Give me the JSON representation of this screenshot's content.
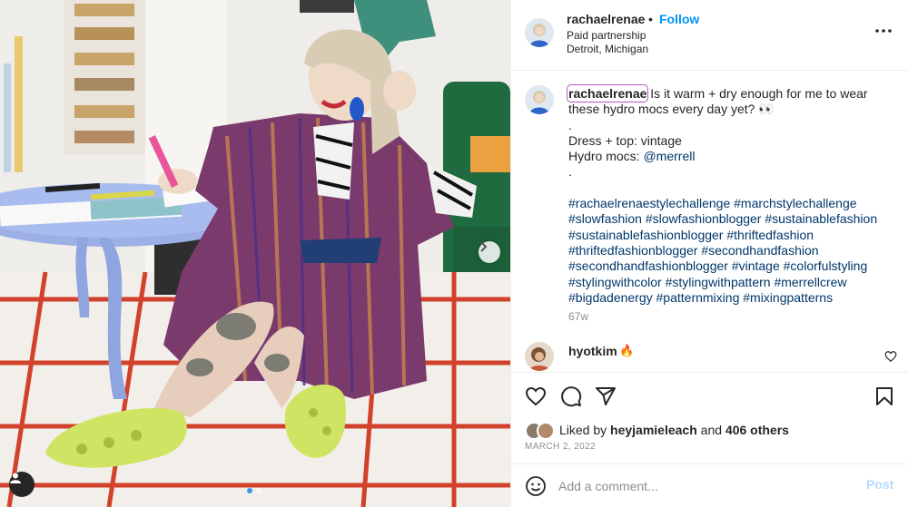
{
  "post": {
    "author": "rachaelrenae",
    "bullet": "•",
    "follow_label": "Follow",
    "partnership": "Paid partnership",
    "location": "Detroit, Michigan"
  },
  "caption": {
    "username": "rachaelrenae",
    "line1": " Is it warm + dry enough for me to wear",
    "line2": "these hydro mocs every day yet? 👀",
    "line3": ".",
    "line4": "Dress + top: vintage",
    "line5_prefix": "Hydro mocs: ",
    "line5_mention": "@merrell",
    "line6": ".",
    "hashtags": [
      "#rachaelrenaestylechallenge #marchstylechallenge",
      "#slowfashion #slowfashionblogger #sustainablefashion",
      "#sustainablefashionblogger #thriftedfashion",
      "#thriftedfashionblogger #secondhandfashion",
      "#secondhandfashionblogger #vintage #colorfulstyling",
      "#stylingwithcolor #stylingwithpattern #merrellcrew",
      "#bigdadenergy #patternmixing #mixingpatterns"
    ],
    "age": "67w"
  },
  "comment": {
    "username": "hyotkim",
    "text": "🔥"
  },
  "likes": {
    "prefix": "Liked by ",
    "user": "heyjamieleach",
    "middle": " and ",
    "count": "406 others",
    "date": "MARCH 2, 2022"
  },
  "composer": {
    "placeholder": "Add a comment...",
    "post_label": "Post"
  },
  "carousel": {
    "current_slide": 1,
    "total_slides": 2
  },
  "colors": {
    "follow_blue": "#0095f6",
    "hashtag_blue": "#00376b",
    "post_disabled": "#b3dbff",
    "secondary_text": "#8e8e8e"
  },
  "icons": [
    "more-icon",
    "heart-icon",
    "comment-icon",
    "share-icon",
    "bookmark-icon",
    "emoji-icon",
    "chevron-right-icon",
    "user-tag-icon"
  ]
}
